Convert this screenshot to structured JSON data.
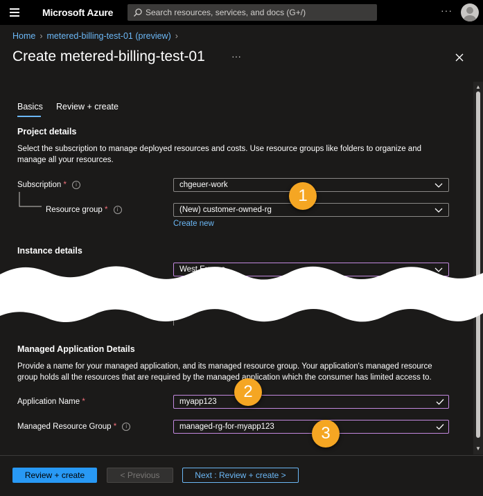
{
  "topbar": {
    "brand": "Microsoft Azure",
    "search_placeholder": "Search resources, services, and docs (G+/)",
    "more_label": "···"
  },
  "breadcrumb": [
    "Home",
    "metered-billing-test-01 (preview)"
  ],
  "page": {
    "title": "Create metered-billing-test-01",
    "more_label": "···"
  },
  "tabs": [
    {
      "label": "Basics",
      "active": true
    },
    {
      "label": "Review + create",
      "active": false
    }
  ],
  "project": {
    "heading": "Project details",
    "description_line1": "Select the subscription to manage deployed resources and costs. Use resource groups like folders to organize and",
    "description_line2": "manage all your resources.",
    "subscription_label": "Subscription",
    "subscription_value": "chgeuer-work",
    "resource_group_label": "Resource group",
    "resource_group_value": "(New) customer-owned-rg",
    "create_new": "Create new"
  },
  "instance": {
    "heading": "Instance details",
    "region_value": "West Europe"
  },
  "managed": {
    "heading": "Managed Application Details",
    "description_line1": "Provide a name for your managed application, and its managed resource group. Your application's managed resource",
    "description_line2": "group holds all the resources that are required by the managed application which the consumer has limited access to.",
    "app_name_label": "Application Name",
    "app_name_value": "myapp123",
    "mrg_label": "Managed Resource Group",
    "mrg_value": "managed-rg-for-myapp123"
  },
  "required_mark": "*",
  "callouts": [
    "1",
    "2",
    "3"
  ],
  "footer": {
    "review_create": "Review + create",
    "previous": "< Previous",
    "next": "Next : Review + create >"
  },
  "colors": {
    "accent": "#2899f5",
    "link": "#6cb8f6",
    "callout": "#f5a623",
    "focus_border": "#c48ae0"
  }
}
